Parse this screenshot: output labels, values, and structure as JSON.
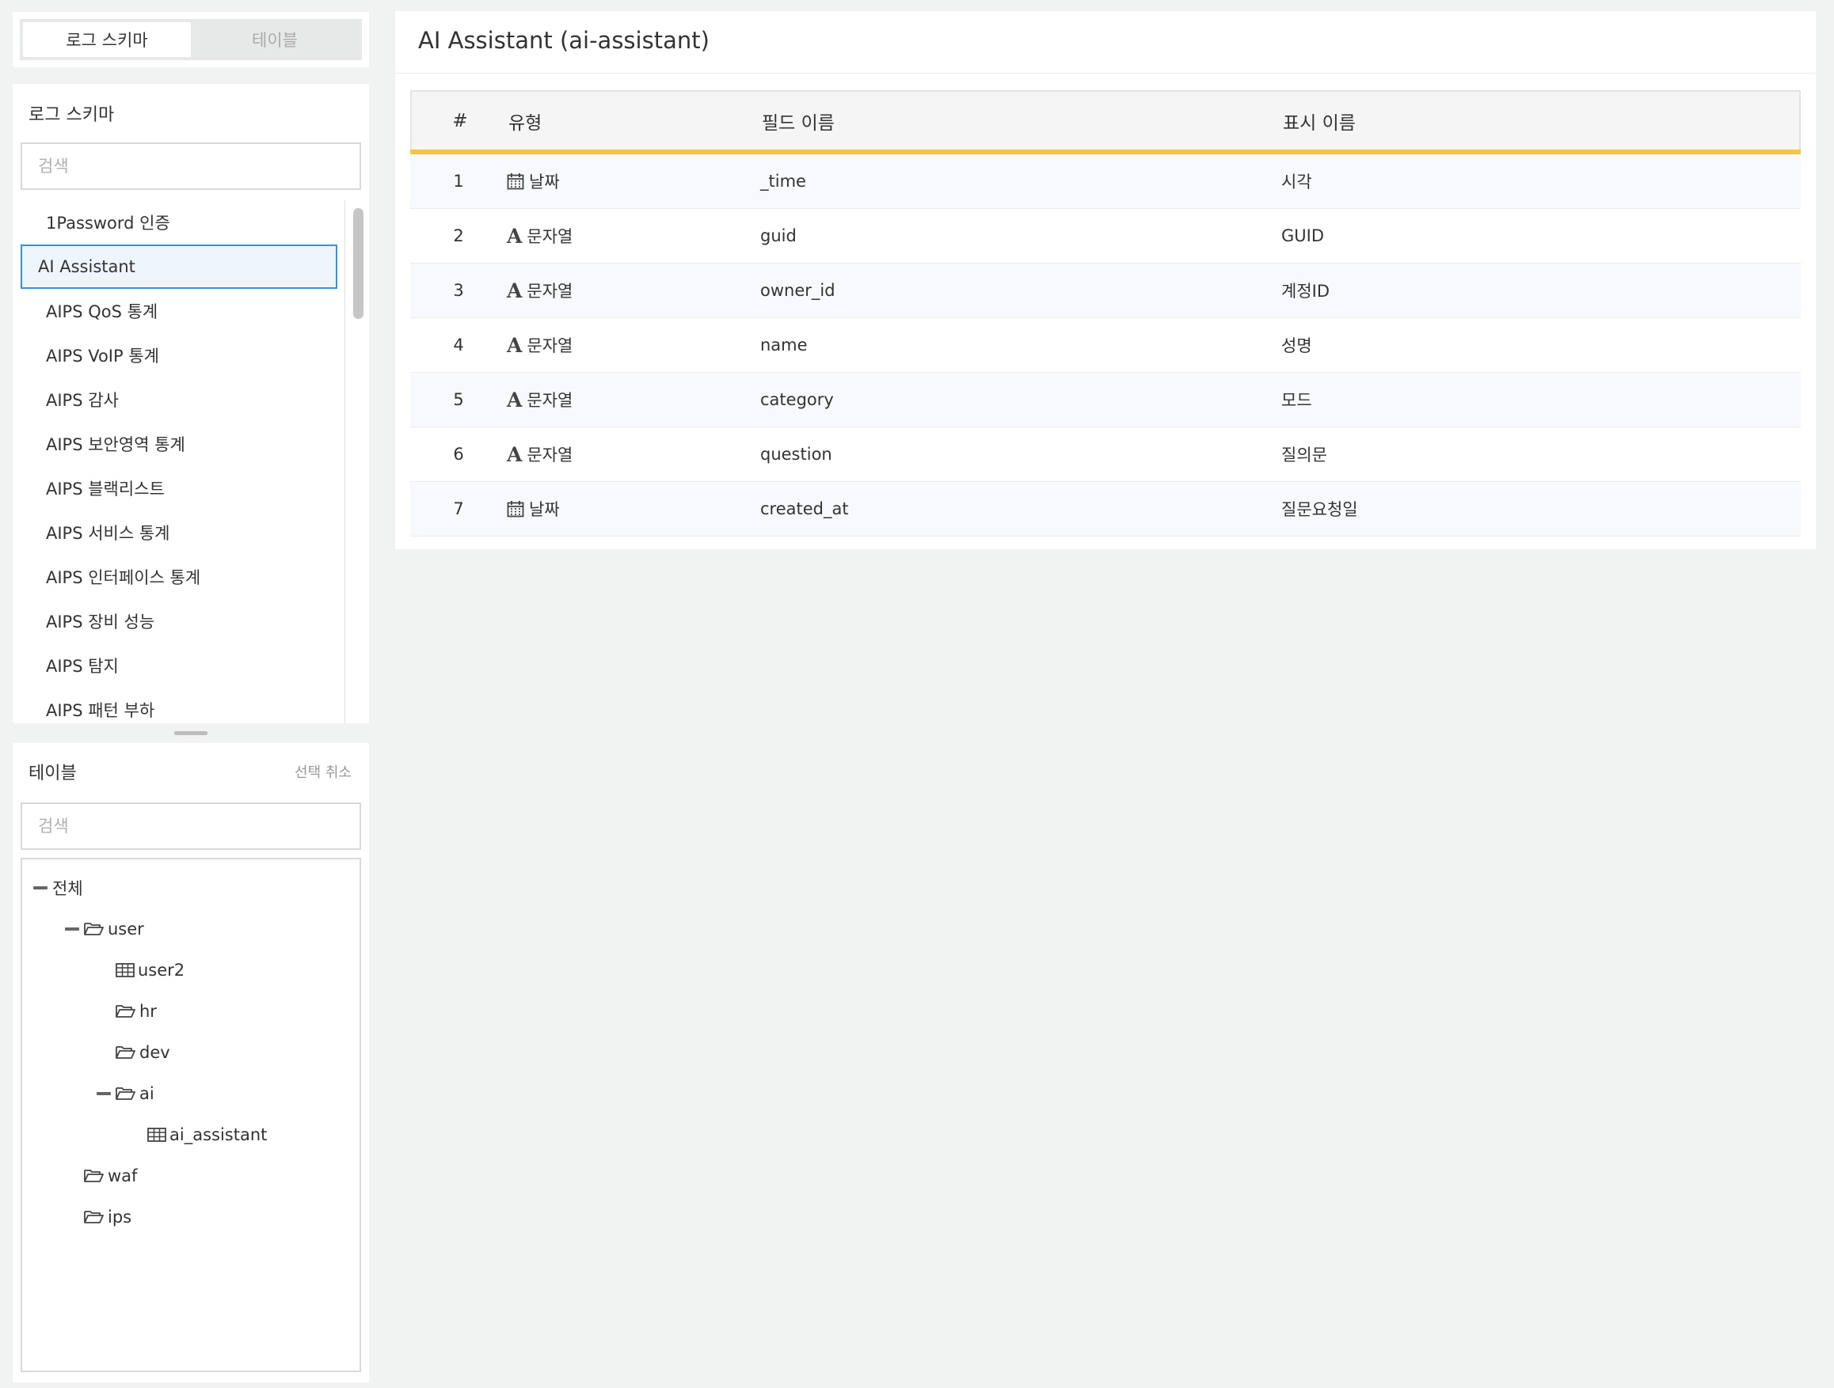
{
  "tabs": [
    {
      "label": "로그 스키마",
      "active": true
    },
    {
      "label": "테이블",
      "active": false
    }
  ],
  "schema_panel": {
    "title": "로그 스키마",
    "search_placeholder": "검색",
    "items": [
      "1Password 인증",
      "AI Assistant",
      "AIPS QoS 통계",
      "AIPS VoIP 통계",
      "AIPS 감사",
      "AIPS 보안영역 통계",
      "AIPS 블랙리스트",
      "AIPS 서비스 통계",
      "AIPS 인터페이스 통계",
      "AIPS 장비 성능",
      "AIPS 탐지",
      "AIPS 패턴 부하"
    ],
    "selected_item": "AI Assistant"
  },
  "table_panel": {
    "title": "테이블",
    "deselect_label": "선택 취소",
    "search_placeholder": "검색",
    "tree": {
      "root": "전체",
      "user": "user",
      "user2": "user2",
      "hr": "hr",
      "dev": "dev",
      "ai": "ai",
      "ai_assistant": "ai_assistant",
      "waf": "waf",
      "ips": "ips"
    }
  },
  "main": {
    "title": "AI Assistant (ai-assistant)",
    "columns": {
      "num": "#",
      "type": "유형",
      "field": "필드 이름",
      "display": "표시 이름"
    },
    "rows": [
      {
        "num": "1",
        "type_icon": "calendar-icon",
        "type": "날짜",
        "field": "_time",
        "display": "시각"
      },
      {
        "num": "2",
        "type_icon": "string-icon",
        "type": "문자열",
        "field": "guid",
        "display": "GUID"
      },
      {
        "num": "3",
        "type_icon": "string-icon",
        "type": "문자열",
        "field": "owner_id",
        "display": "계정ID"
      },
      {
        "num": "4",
        "type_icon": "string-icon",
        "type": "문자열",
        "field": "name",
        "display": "성명"
      },
      {
        "num": "5",
        "type_icon": "string-icon",
        "type": "문자열",
        "field": "category",
        "display": "모드"
      },
      {
        "num": "6",
        "type_icon": "string-icon",
        "type": "문자열",
        "field": "question",
        "display": "질의문"
      },
      {
        "num": "7",
        "type_icon": "calendar-icon",
        "type": "날짜",
        "field": "created_at",
        "display": "질문요청일"
      }
    ]
  },
  "colors": {
    "accent_bar": "#f5c444",
    "selection_border": "#3d8fd6",
    "selection_bg": "#eef5fc"
  }
}
